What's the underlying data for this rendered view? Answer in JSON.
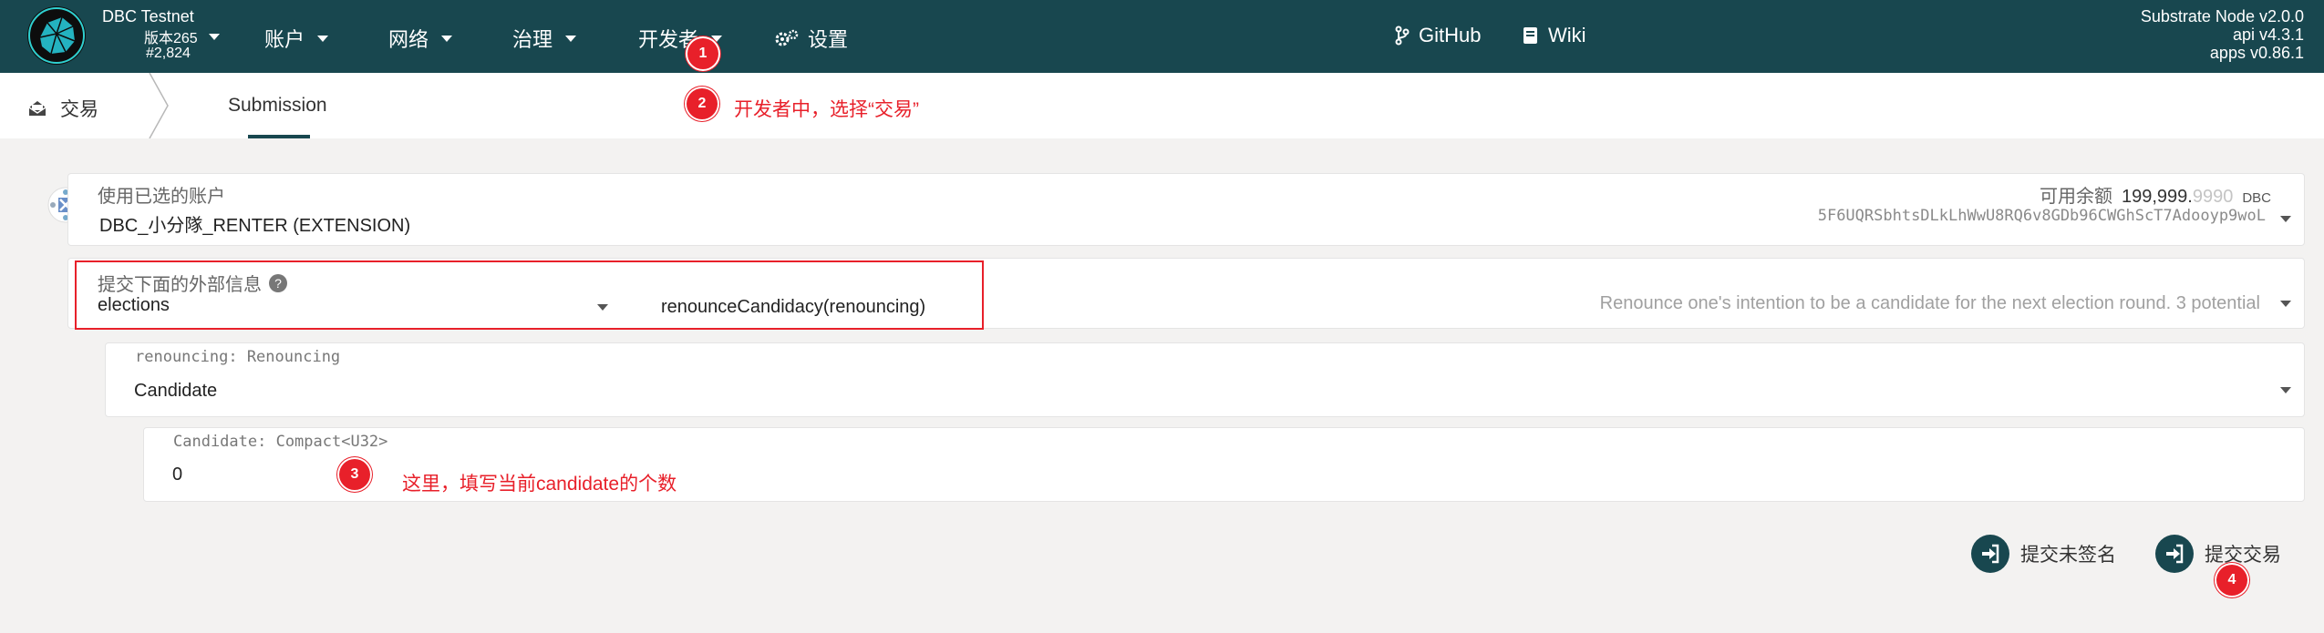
{
  "nav": {
    "chain": {
      "name": "DBC Testnet",
      "version": "版本265",
      "block": "#2,824"
    },
    "menu": [
      {
        "label": "账户"
      },
      {
        "label": "网络"
      },
      {
        "label": "治理"
      },
      {
        "label": "开发者"
      },
      {
        "label": "设置"
      }
    ],
    "links": [
      {
        "label": "GitHub"
      },
      {
        "label": "Wiki"
      }
    ],
    "node": {
      "line1": "Substrate Node v2.0.0",
      "line2": "api v4.3.1",
      "line3": "apps v0.86.1"
    }
  },
  "tabs": {
    "section": "交易",
    "active": "Submission"
  },
  "account": {
    "label": "使用已选的账户",
    "name": "DBC_小分隊_RENTER (EXTENSION)",
    "balance_label": "可用余额",
    "balance_main": "199,999.",
    "balance_decimals": "9990",
    "balance_unit": "DBC",
    "address": "5F6UQRSbhtsDLkLhWwU8RQ6v8GDb96CWGhScT7Adooyp9woL"
  },
  "extrinsic": {
    "label": "提交下面的外部信息",
    "module": "elections",
    "method": "renounceCandidacy(renouncing)",
    "description": "Renounce one's intention to be a candidate for the next election round. 3 potential"
  },
  "param": {
    "label": "renouncing: Renouncing",
    "value": "Candidate",
    "sub_label": "Candidate: Compact<U32>",
    "sub_value": "0"
  },
  "actions": {
    "unsigned": "提交未签名",
    "submit": "提交交易"
  },
  "annotations": {
    "badge1": "1",
    "badge2": "2",
    "note2": "开发者中，选择“交易”",
    "badge3": "3",
    "note3": "这里，填写当前candidate的个数",
    "badge4": "4"
  },
  "colors": {
    "nav_bg": "#18474f",
    "annotation_red": "#e8202a",
    "page_bg": "#f3f2f1"
  }
}
